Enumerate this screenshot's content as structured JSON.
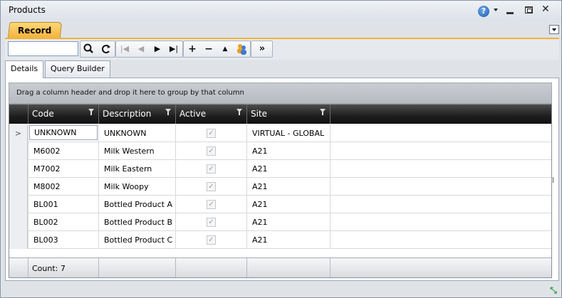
{
  "window": {
    "title": "Products"
  },
  "titlebar": {
    "help_icon": "help-icon",
    "help_text": "?"
  },
  "record_tab": {
    "label": "Record"
  },
  "toolbar": {
    "search_value": "",
    "icons": [
      "search-icon",
      "refresh-icon",
      "first-icon",
      "prev-icon",
      "next-icon",
      "last-icon",
      "add-icon",
      "remove-icon",
      "up-icon",
      "users-icon",
      "more-icon"
    ]
  },
  "sub_tabs": [
    {
      "label": "Details",
      "active": true
    },
    {
      "label": "Query Builder",
      "active": false
    }
  ],
  "group_panel": {
    "text": "Drag a column header and drop it here to group by that column"
  },
  "grid": {
    "columns": [
      "Code",
      "Description",
      "Active",
      "Site"
    ],
    "rows": [
      {
        "code": "UNKNOWN",
        "description": "UNKNOWN",
        "active": true,
        "site": "VIRTUAL - GLOBAL"
      },
      {
        "code": "M6002",
        "description": "Milk Western",
        "active": true,
        "site": "A21"
      },
      {
        "code": "M7002",
        "description": "Milk Eastern",
        "active": true,
        "site": "A21"
      },
      {
        "code": "M8002",
        "description": "Milk Woopy",
        "active": true,
        "site": "A21"
      },
      {
        "code": "BL001",
        "description": "Bottled Product A",
        "active": true,
        "site": "A21"
      },
      {
        "code": "BL002",
        "description": "Bottled Product B",
        "active": true,
        "site": "A21"
      },
      {
        "code": "BL003",
        "description": "Bottled Product C",
        "active": true,
        "site": "A21"
      }
    ],
    "row_indicator": ">",
    "footer_count": "Count: 7"
  },
  "colors": {
    "accent_tab": "#f3b239",
    "header_bg": "#1e1e1e"
  }
}
